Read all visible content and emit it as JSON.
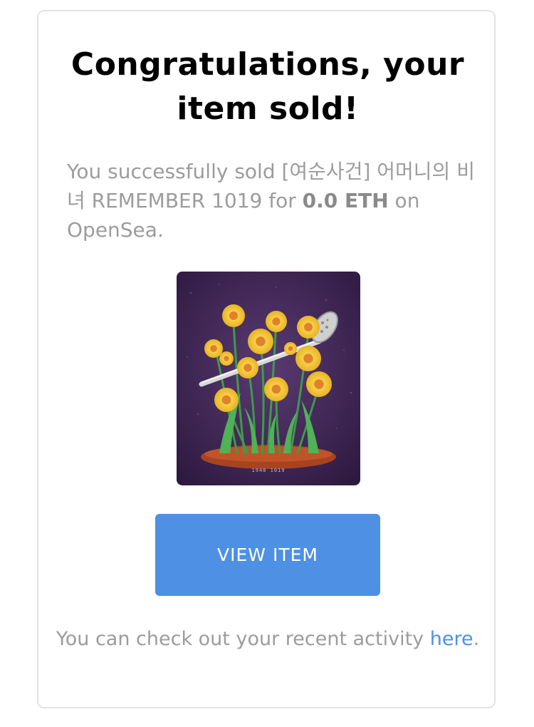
{
  "email": {
    "title_line1": "Congratulations, your",
    "title_line2": "item sold!",
    "message_prefix": "You successfully sold [여순사건] 어머니의 비녀 REMEMBER 1019 for ",
    "price": "0.0 ETH",
    "message_suffix": " on OpenSea.",
    "item_image_caption": "1948 1019",
    "view_button_label": "VIEW ITEM",
    "footer_text": "You can check out your recent activity ",
    "footer_link": "here",
    "footer_end": "."
  },
  "colors": {
    "accent": "#4e90e3",
    "text_muted": "#9c9c9c",
    "art_background": "#3d2550",
    "flower_petal": "#f2c12e",
    "flower_center": "#e0822a",
    "soil": "#a8431f"
  }
}
